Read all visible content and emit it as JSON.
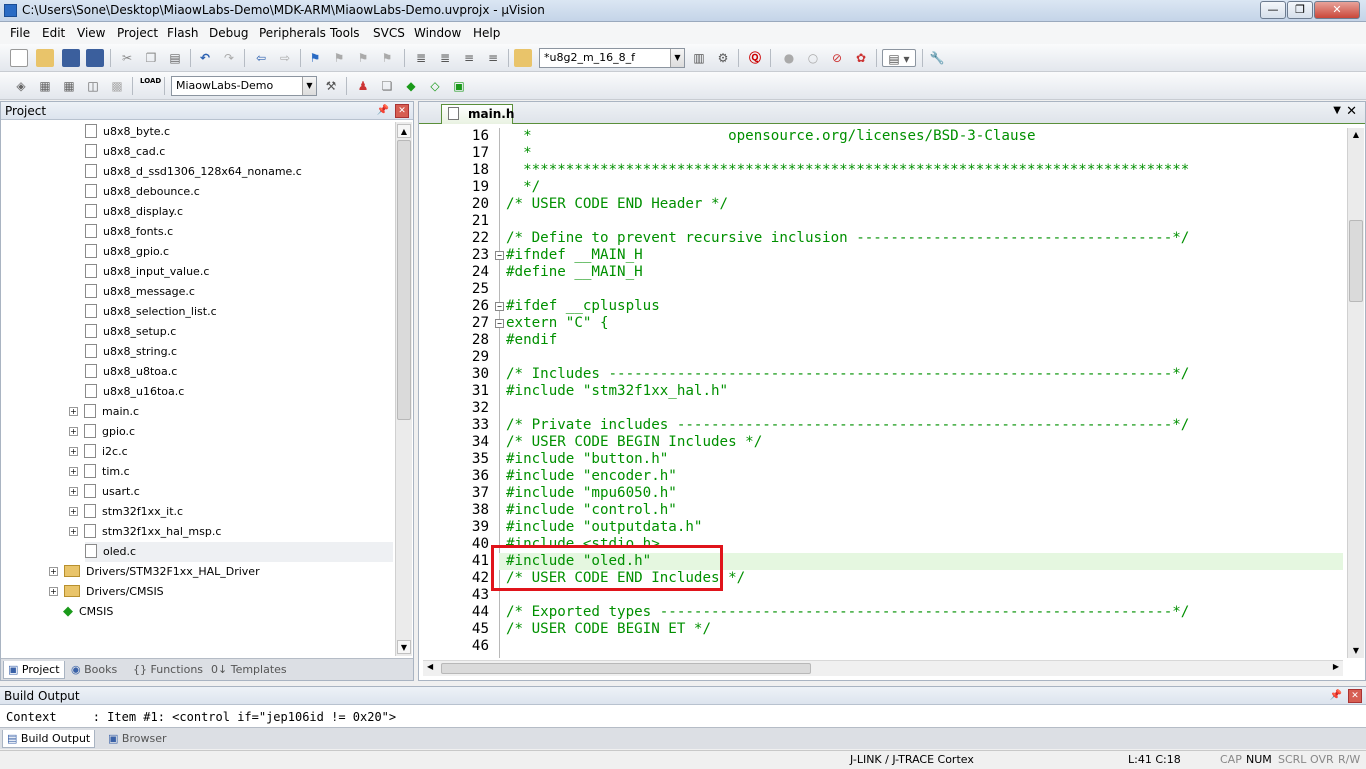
{
  "window": {
    "title": "C:\\Users\\Sone\\Desktop\\MiaowLabs-Demo\\MDK-ARM\\MiaowLabs-Demo.uvprojx - µVision"
  },
  "menu": [
    "File",
    "Edit",
    "View",
    "Project",
    "Flash",
    "Debug",
    "Peripherals",
    "Tools",
    "SVCS",
    "Window",
    "Help"
  ],
  "toolbar": {
    "target_combo": "*u8g2_m_16_8_f",
    "project_combo": "MiaowLabs-Demo",
    "load_label": "LOAD"
  },
  "project_panel": {
    "title": "Project",
    "items": [
      {
        "label": "u8x8_byte.c"
      },
      {
        "label": "u8x8_cad.c"
      },
      {
        "label": "u8x8_d_ssd1306_128x64_noname.c"
      },
      {
        "label": "u8x8_debounce.c"
      },
      {
        "label": "u8x8_display.c"
      },
      {
        "label": "u8x8_fonts.c"
      },
      {
        "label": "u8x8_gpio.c"
      },
      {
        "label": "u8x8_input_value.c"
      },
      {
        "label": "u8x8_message.c"
      },
      {
        "label": "u8x8_selection_list.c"
      },
      {
        "label": "u8x8_setup.c"
      },
      {
        "label": "u8x8_string.c"
      },
      {
        "label": "u8x8_u8toa.c"
      },
      {
        "label": "u8x8_u16toa.c"
      },
      {
        "label": "main.c"
      },
      {
        "label": "gpio.c"
      },
      {
        "label": "i2c.c"
      },
      {
        "label": "tim.c"
      },
      {
        "label": "usart.c"
      },
      {
        "label": "stm32f1xx_it.c"
      },
      {
        "label": "stm32f1xx_hal_msp.c"
      },
      {
        "label": "oled.c"
      },
      {
        "label": "Drivers/STM32F1xx_HAL_Driver"
      },
      {
        "label": "Drivers/CMSIS"
      },
      {
        "label": "CMSIS"
      }
    ],
    "tabs": [
      "Project",
      "Books",
      "Functions",
      "Templates"
    ]
  },
  "editor": {
    "tab": "main.h",
    "lines": [
      {
        "n": "16",
        "t": "  *                       opensource.org/licenses/BSD-3-Clause"
      },
      {
        "n": "17",
        "t": "  *"
      },
      {
        "n": "18",
        "t": "  ******************************************************************************"
      },
      {
        "n": "19",
        "t": "  */"
      },
      {
        "n": "20",
        "t": "/* USER CODE END Header */"
      },
      {
        "n": "21",
        "t": ""
      },
      {
        "n": "22",
        "t": "/* Define to prevent recursive inclusion -------------------------------------*/"
      },
      {
        "n": "23",
        "t": "#ifndef __MAIN_H"
      },
      {
        "n": "24",
        "t": "#define __MAIN_H"
      },
      {
        "n": "25",
        "t": ""
      },
      {
        "n": "26",
        "t": "#ifdef __cplusplus"
      },
      {
        "n": "27",
        "t": "extern \"C\" {"
      },
      {
        "n": "28",
        "t": "#endif"
      },
      {
        "n": "29",
        "t": ""
      },
      {
        "n": "30",
        "t": "/* Includes ------------------------------------------------------------------*/"
      },
      {
        "n": "31",
        "t": "#include \"stm32f1xx_hal.h\""
      },
      {
        "n": "32",
        "t": ""
      },
      {
        "n": "33",
        "t": "/* Private includes ----------------------------------------------------------*/"
      },
      {
        "n": "34",
        "t": "/* USER CODE BEGIN Includes */"
      },
      {
        "n": "35",
        "t": "#include \"button.h\""
      },
      {
        "n": "36",
        "t": "#include \"encoder.h\""
      },
      {
        "n": "37",
        "t": "#include \"mpu6050.h\""
      },
      {
        "n": "38",
        "t": "#include \"control.h\""
      },
      {
        "n": "39",
        "t": "#include \"outputdata.h\""
      },
      {
        "n": "40",
        "t": "#include <stdio.h>"
      },
      {
        "n": "41",
        "t": "#include \"oled.h\""
      },
      {
        "n": "42",
        "t": "/* USER CODE END Includes */"
      },
      {
        "n": "43",
        "t": ""
      },
      {
        "n": "44",
        "t": "/* Exported types ------------------------------------------------------------*/"
      },
      {
        "n": "45",
        "t": "/* USER CODE BEGIN ET */"
      },
      {
        "n": "46",
        "t": ""
      }
    ]
  },
  "build_output": {
    "title": "Build Output",
    "text": "Context     : Item #1: <control if=\"jep106id != 0x20\">",
    "tabs": [
      "Build Output",
      "Browser"
    ]
  },
  "status": {
    "debugger": "J-LINK / J-TRACE Cortex",
    "position": "L:41 C:18",
    "caps": "CAP",
    "num": "NUM",
    "scrl": "SCRL",
    "ovr": "OVR",
    "rw": "R/W"
  },
  "colors": {
    "code": "#009000",
    "highlight_line": "#e5f7e0",
    "annotation_box": "#e0141b"
  }
}
